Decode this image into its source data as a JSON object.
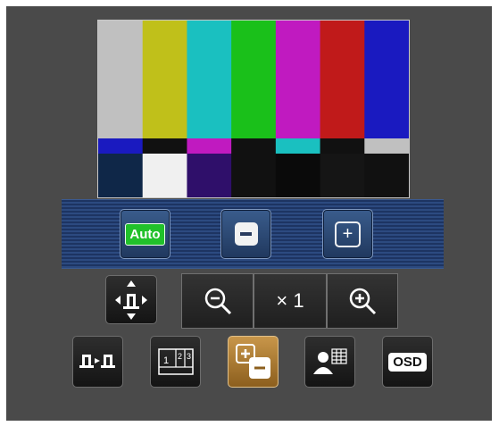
{
  "preview": {
    "top_bars": [
      "#c0c0c0",
      "#c0c01a",
      "#1ac0c0",
      "#1ac01a",
      "#c01ac0",
      "#c01a1a",
      "#1a1ac0"
    ],
    "mid_bars": [
      "#1a1ac0",
      "#111111",
      "#c01ac0",
      "#111111",
      "#1ac0c0",
      "#111111",
      "#c0c0c0"
    ],
    "bottom_bars": [
      "#0f2748",
      "#f0f0f0",
      "#2f0f6a",
      "#111111",
      "#0a0a0a",
      "#151515",
      "#111111"
    ]
  },
  "focus": {
    "auto_label": "Auto",
    "near_icon": "minus-icon",
    "far_icon": "plus-icon"
  },
  "zoom": {
    "out_icon": "zoom-out-icon",
    "level": "× 1",
    "in_icon": "zoom-in-icon"
  },
  "toolbar": {
    "camera_swap_icon": "camera-swap-icon",
    "preset_label": "1 2 3",
    "osd_label": "OSD"
  },
  "colors": {
    "panel_bg": "#4a4a4a",
    "focus_strip": "#1d3462",
    "accent_orange": "#c8964a",
    "auto_green": "#21c12a"
  }
}
